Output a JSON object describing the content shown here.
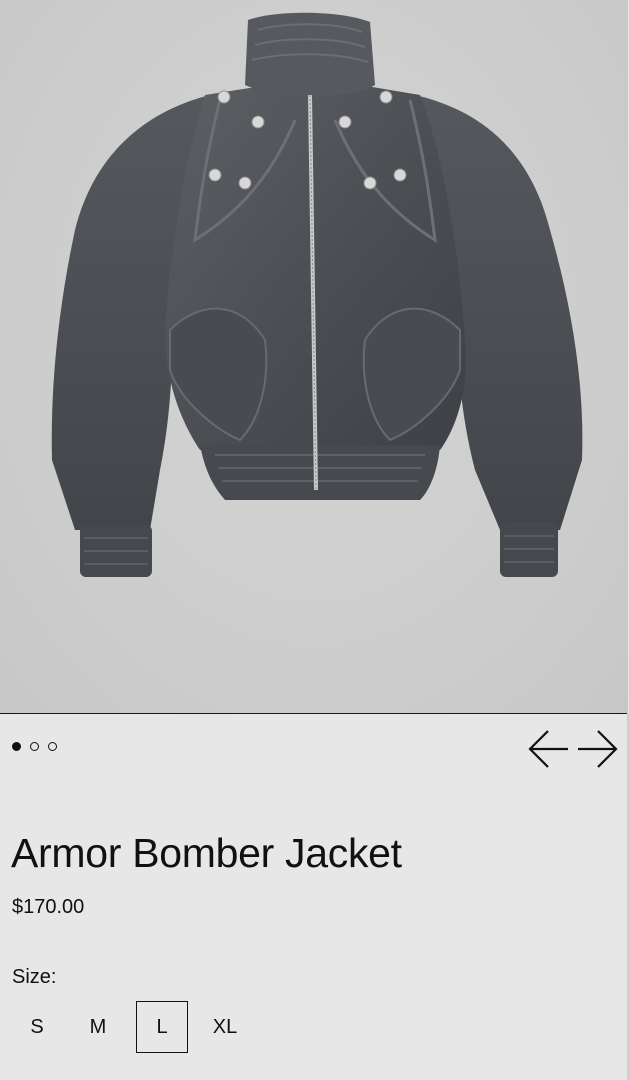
{
  "product": {
    "title": "Armor Bomber Jacket",
    "price": "$170.00",
    "image": {
      "description": "Washed grey denim bomber jacket with snap buttons, zip front and ribbed cuffs",
      "icon": "jacket-photo"
    }
  },
  "carousel": {
    "slides": 3,
    "active_index": 0,
    "prev_icon": "arrow-left-icon",
    "next_icon": "arrow-right-icon"
  },
  "size": {
    "label": "Size:",
    "options": [
      "S",
      "M",
      "L",
      "XL"
    ],
    "selected": "L"
  },
  "colors": {
    "background": "#e7e7e7",
    "text": "#111111",
    "jacket": "#4d5054"
  }
}
